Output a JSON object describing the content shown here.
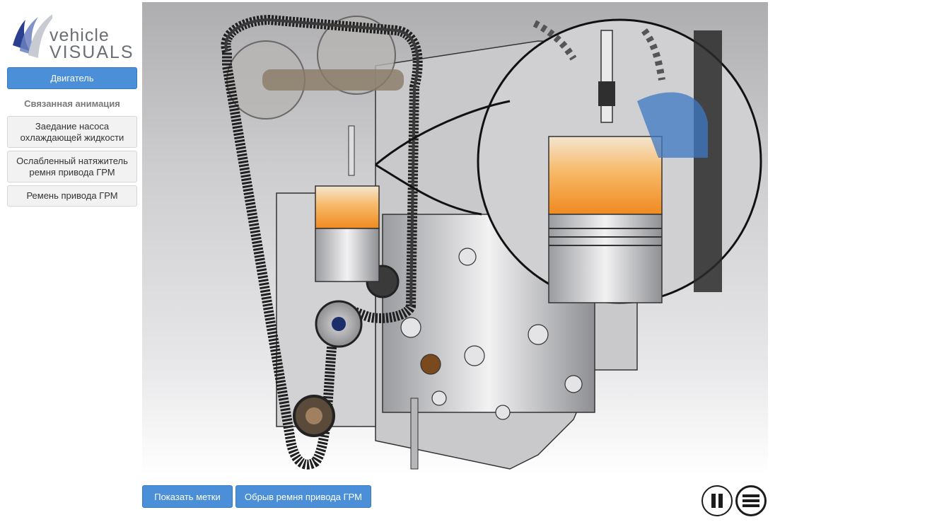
{
  "logo": {
    "line1": "vehicle",
    "line2": "VISUALS"
  },
  "sidebar": {
    "main_button": "Двигатель",
    "related_title": "Связанная анимация",
    "items": [
      {
        "label": "Заедание насоса охлаждающей жидкости"
      },
      {
        "label": "Ослабленный натяжитель ремня привода ГРМ"
      },
      {
        "label": "Ремень привода ГРМ"
      }
    ]
  },
  "viewer": {
    "image": "engine-cutaway-timing-belt-illustration"
  },
  "bottom": {
    "show_labels": "Показать метки",
    "belt_break": "Обрыв ремня привода ГРМ"
  },
  "controls": {
    "pause_icon": "pause-icon",
    "menu_icon": "menu-icon"
  },
  "colors": {
    "accent": "#4a8fd8",
    "secondary_button": "#f2f2f2"
  }
}
